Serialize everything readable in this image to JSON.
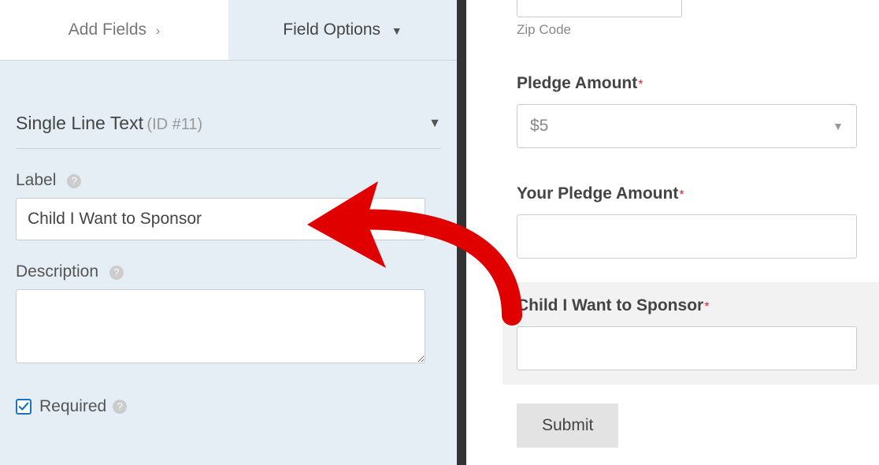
{
  "tabs": {
    "add_fields": "Add Fields",
    "field_options": "Field Options"
  },
  "field": {
    "title": "Single Line Text",
    "id": "(ID #11)",
    "label_heading": "Label",
    "label_value": "Child I Want to Sponsor",
    "description_heading": "Description",
    "description_value": "",
    "required_label": "Required",
    "required_checked": true
  },
  "preview": {
    "zip_label": "Zip Code",
    "pledge_label": "Pledge Amount",
    "pledge_value": "$5",
    "your_pledge_label": "Your Pledge Amount",
    "child_label": "Child I Want to Sponsor",
    "submit_label": "Submit"
  }
}
